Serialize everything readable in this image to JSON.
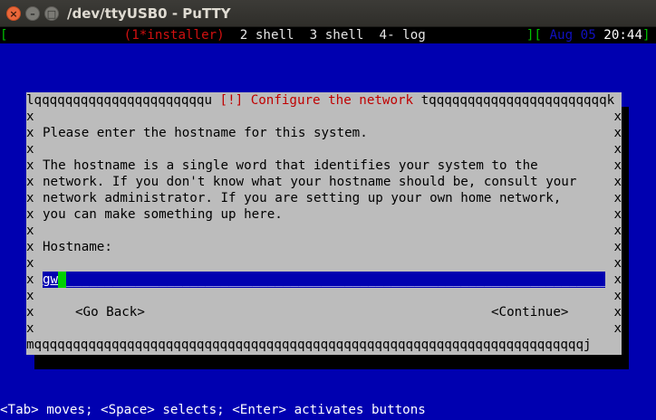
{
  "window": {
    "title": "/dev/ttyUSB0 - PuTTY",
    "buttons": {
      "close": "×",
      "minimize": "–",
      "maximize": "□"
    }
  },
  "screen_bar": {
    "left_bracket": "[",
    "current_window": "(1*installer)",
    "windows": "  2 shell  3 shell  4- log",
    "right_bracket": "][",
    "date": " Aug 05",
    "time": " 20:44",
    "end_bracket": "]"
  },
  "dialog": {
    "top_left_line": "lqqqqqqqqqqqqqqqqqqqqqqu ",
    "title": "[!] Configure the network",
    "top_right_line": " tqqqqqqqqqqqqqqqqqqqqqqqk",
    "side_char": "x",
    "prompt": "Please enter the hostname for this system.",
    "description": [
      "The hostname is a single word that identifies your system to the",
      "network. If you don't know what your hostname should be, consult your",
      "network administrator. If you are setting up your own home network,",
      "you can make something up here."
    ],
    "field_label": "Hostname:",
    "field_value": "gw",
    "field_fill": "_______________________________________________________________________",
    "go_back": "<Go Back>",
    "continue": "<Continue>",
    "bottom_line": "mqqqqqqqqqqqqqqqqqqqqqqqqqqqqqqqqqqqqqqqqqqqqqqqqqqqqqqqqqqqqqqqqqqqqqqqj"
  },
  "status_line": "<Tab> moves; <Space> selects; <Enter> activates buttons",
  "colors": {
    "terminal_bg": "#0000b0",
    "dialog_bg": "#bcbcbc",
    "title_red": "#c00000",
    "cursor_green": "#00d000"
  }
}
